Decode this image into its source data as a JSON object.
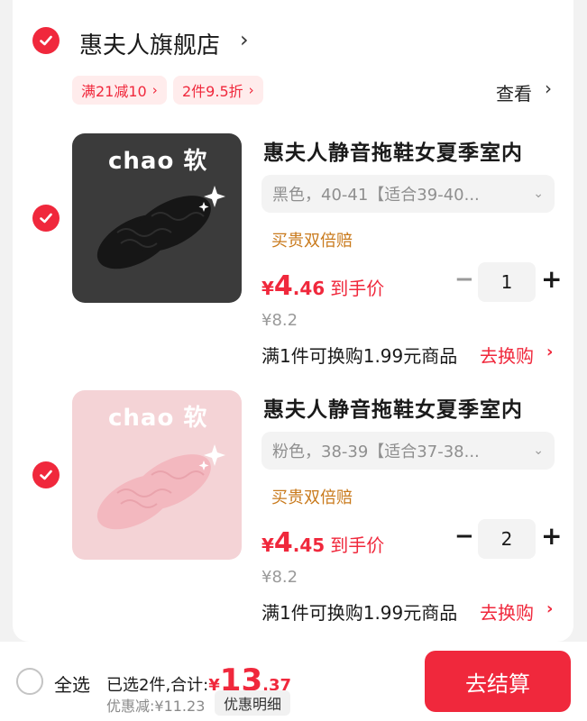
{
  "store": {
    "name": "惠夫人旗舰店",
    "arrow": "›",
    "promos": [
      {
        "label": "满21减10",
        "chevron": "›"
      },
      {
        "label": "2件9.5折",
        "chevron": "›"
      }
    ],
    "view_label": "查看",
    "view_arrow": "›"
  },
  "items": [
    {
      "thumb_text": "chao 软",
      "thumb_color": "#3b3b3b",
      "product_color": "#161616",
      "title": "惠夫人静音拖鞋女夏季室内",
      "variant": "黑色，40-41【适合39-40...",
      "variant_chevron": "⌄",
      "badge": "买贵双倍赔",
      "price_currency": "¥",
      "price_int": "4",
      "price_dec": ".46",
      "price_label": "到手价",
      "original_price": "¥8.2",
      "quantity": "1",
      "minus": "−",
      "plus": "+",
      "exchange_text": "满1件可换购1.99元商品",
      "exchange_link": "去换购",
      "exchange_arrow": "›"
    },
    {
      "thumb_text": "chao 软",
      "thumb_color": "#f4d3d6",
      "product_color": "#f3b8bf",
      "title": "惠夫人静音拖鞋女夏季室内",
      "variant": "粉色，38-39【适合37-38...",
      "variant_chevron": "⌄",
      "badge": "买贵双倍赔",
      "price_currency": "¥",
      "price_int": "4",
      "price_dec": ".45",
      "price_label": "到手价",
      "original_price": "¥8.2",
      "quantity": "2",
      "minus": "−",
      "plus": "+",
      "exchange_text": "满1件可换购1.99元商品",
      "exchange_link": "去换购",
      "exchange_arrow": "›"
    }
  ],
  "footer": {
    "select_all": "全选",
    "summary_label": "已选2件,合计:",
    "total_currency": "¥",
    "total_int": "13",
    "total_dec": ".37",
    "discount": "优惠减:¥11.23",
    "detail_button": "优惠明细",
    "checkout_button": "去结算"
  },
  "colors": {
    "accent": "#f0283c",
    "badge": "#c97a1c",
    "promo_bg": "#ffecec"
  }
}
